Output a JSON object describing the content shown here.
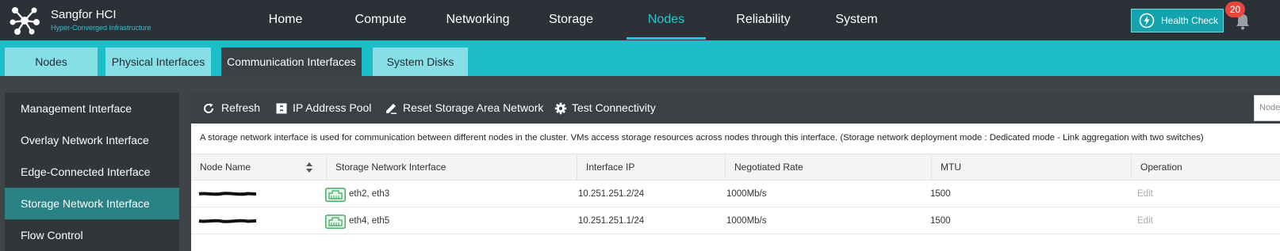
{
  "header": {
    "brand_title": "Sangfor HCI",
    "brand_subtitle": "Hyper-Converged Infrastructure",
    "nav": [
      "Home",
      "Compute",
      "Networking",
      "Storage",
      "Nodes",
      "Reliability",
      "System"
    ],
    "active_nav": "Nodes",
    "health_check_label": "Health Check",
    "notification_count": "20",
    "accent_color": "#24c6d1"
  },
  "subnav": {
    "tabs": [
      "Nodes",
      "Physical Interfaces",
      "Communication Interfaces",
      "System Disks"
    ],
    "active_tab": "Communication Interfaces"
  },
  "sidebar": {
    "items": [
      "Management Interface",
      "Overlay Network Interface",
      "Edge-Connected Interface",
      "Storage Network Interface",
      "Flow Control"
    ],
    "active_item": "Storage Network Interface"
  },
  "toolbar": {
    "refresh_label": "Refresh",
    "ip_pool_label": "IP Address Pool",
    "reset_san_label": "Reset Storage Area Network",
    "test_conn_label": "Test Connectivity",
    "search_placeholder": "Node"
  },
  "description": "A storage network interface is used for communication between different nodes in the cluster. VMs access storage resources across nodes through this interface. (Storage network deployment mode : Dedicated mode - Link aggregation with two switches)",
  "table": {
    "columns": [
      "Node Name",
      "Storage Network Interface",
      "Interface IP",
      "Negotiated Rate",
      "MTU",
      "Operation"
    ],
    "rows": [
      {
        "interfaces": "eth2, eth3",
        "ip": "10.251.251.2/24",
        "rate": "1000Mb/s",
        "mtu": "1500",
        "operation": "Edit"
      },
      {
        "interfaces": "eth4, eth5",
        "ip": "10.251.251.1/24",
        "rate": "1000Mb/s",
        "mtu": "1500",
        "operation": "Edit"
      }
    ]
  }
}
